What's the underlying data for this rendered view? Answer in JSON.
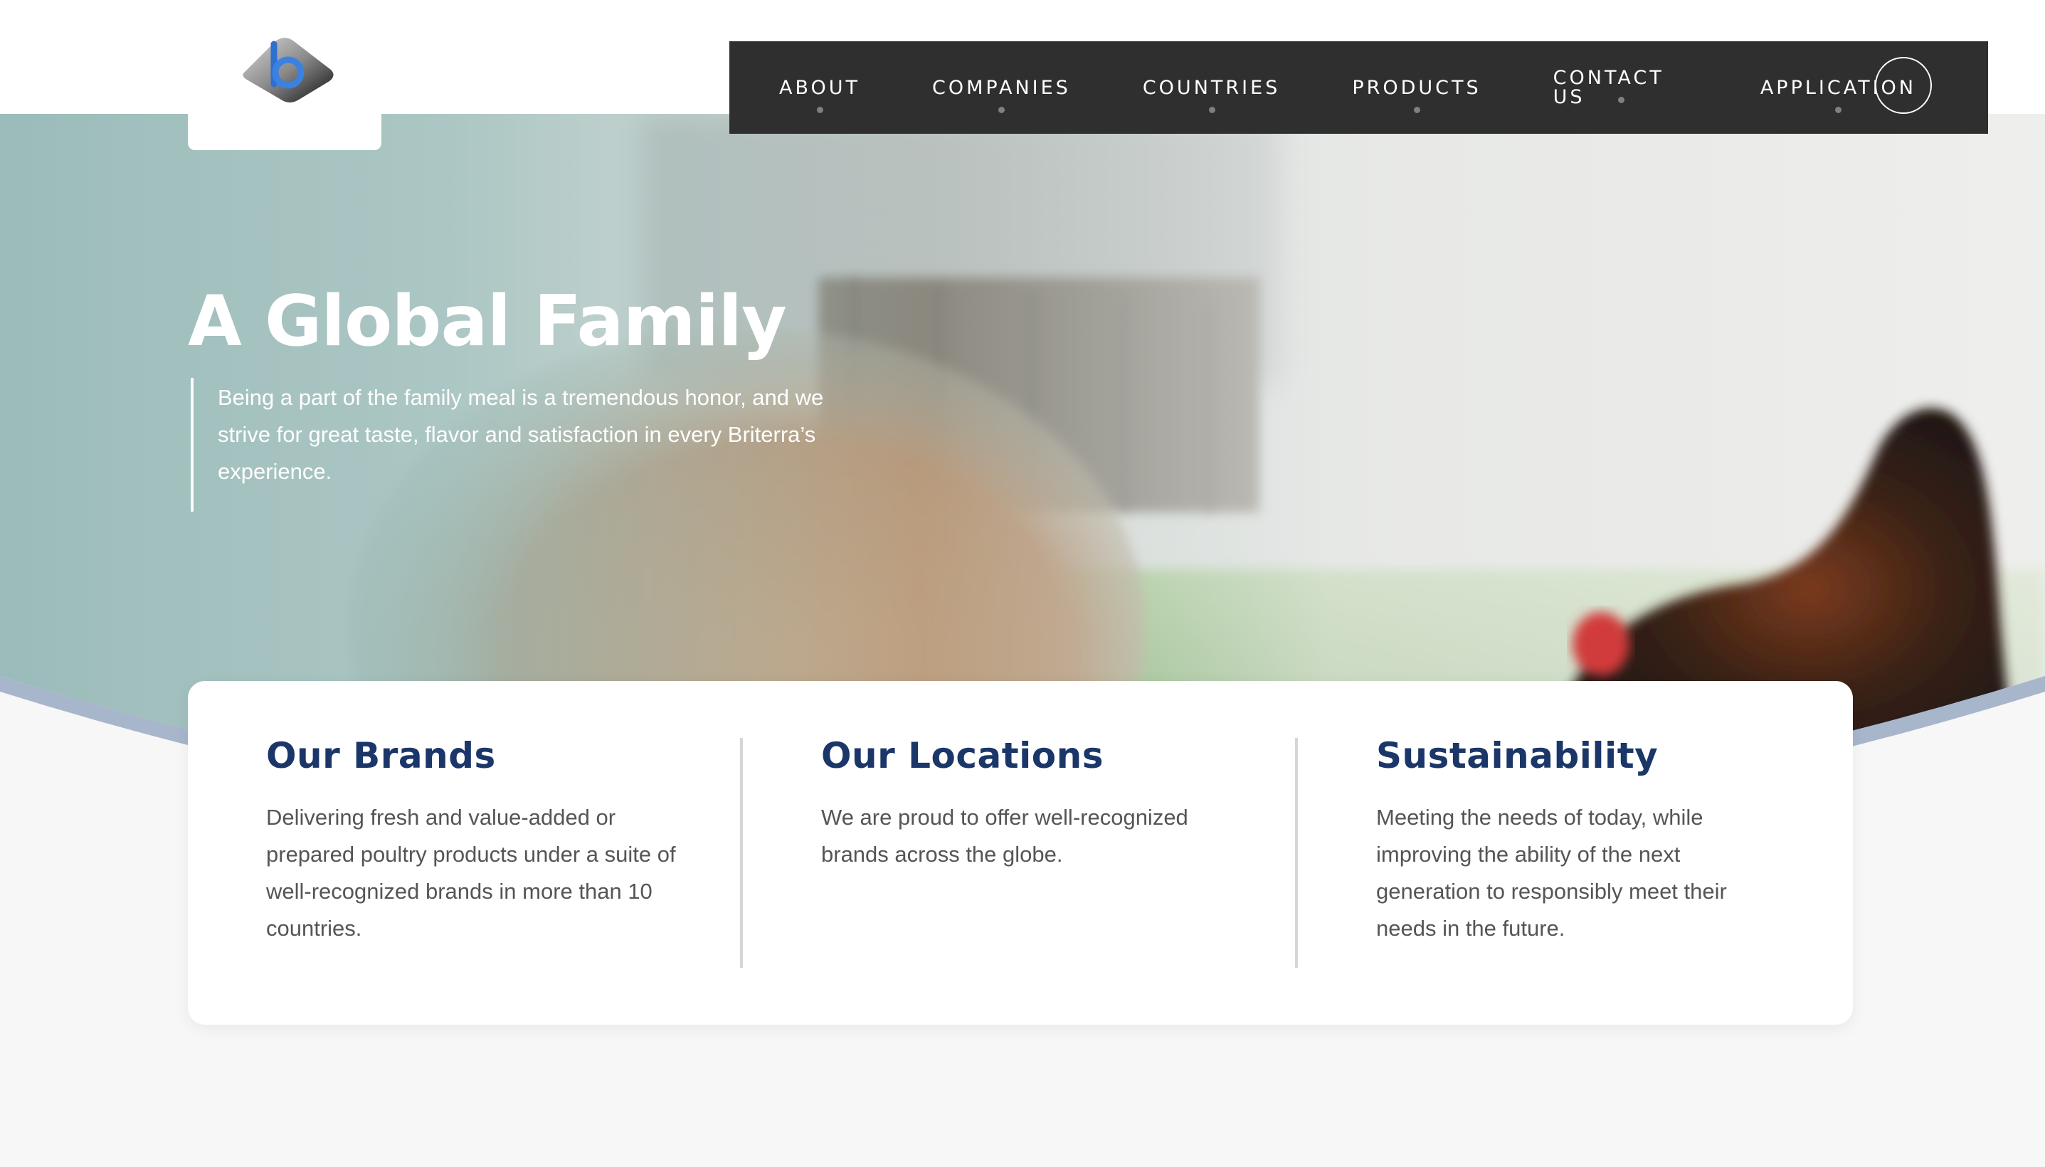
{
  "nav": {
    "items": [
      "ABOUT",
      "COMPANIES",
      "COUNTRIES",
      "PRODUCTS",
      "CONTACT US",
      "APPLICATION"
    ]
  },
  "hero": {
    "title": "A Global Family",
    "text": "Being a part of the family meal is a tremendous honor, and we strive for great taste, flavor and satisfaction in every Briterra’s experience."
  },
  "features": [
    {
      "title": "Our Brands",
      "text": "Delivering fresh and value-added or prepared poultry products under a suite of well-recognized brands in more than 10 countries."
    },
    {
      "title": "Our Locations",
      "text": "We are proud to offer well-recognized brands across the globe."
    },
    {
      "title": "Sustainability",
      "text": "Meeting the needs of today, while improving the ability of the next generation to responsibly meet their needs in the future."
    }
  ],
  "colors": {
    "nav_bg": "#2f2f2f",
    "heading_blue": "#1b3668",
    "body_text": "#555555",
    "hero_teal": "#8fb5b5",
    "page_bg": "#f7f7f7"
  },
  "icons": {
    "logo": "briterra-b-logo",
    "nav_circle": "search-icon"
  }
}
